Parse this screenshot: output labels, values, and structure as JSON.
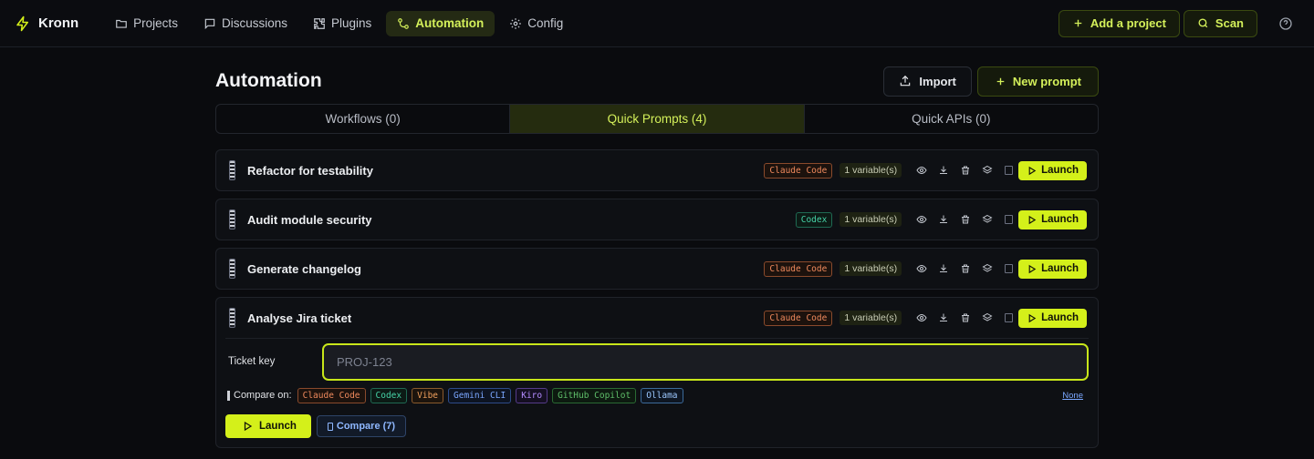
{
  "app": {
    "name": "Kronn",
    "colors": {
      "accent": "#d4f01a",
      "background": "#0a0b0e"
    }
  },
  "nav": {
    "items": [
      {
        "label": "Projects",
        "icon": "folder-icon"
      },
      {
        "label": "Discussions",
        "icon": "chat-icon"
      },
      {
        "label": "Plugins",
        "icon": "puzzle-icon"
      },
      {
        "label": "Automation",
        "icon": "workflow-icon",
        "active": true
      },
      {
        "label": "Config",
        "icon": "gear-icon"
      }
    ]
  },
  "topbar": {
    "add_project": "Add a project",
    "scan": "Scan"
  },
  "page": {
    "title": "Automation",
    "import_label": "Import",
    "new_prompt_label": "New prompt"
  },
  "tabs": [
    {
      "label": "Workflows (0)"
    },
    {
      "label": "Quick Prompts (4)",
      "active": true
    },
    {
      "label": "Quick APIs (0)"
    }
  ],
  "prompts": [
    {
      "title": "Refactor for testability",
      "agent": "Claude Code",
      "variables": "1 variable(s)",
      "launch": "Launch"
    },
    {
      "title": "Audit module security",
      "agent": "Codex",
      "variables": "1 variable(s)",
      "launch": "Launch"
    },
    {
      "title": "Generate changelog",
      "agent": "Claude Code",
      "variables": "1 variable(s)",
      "launch": "Launch"
    },
    {
      "title": "Analyse Jira ticket",
      "agent": "Claude Code",
      "variables": "1 variable(s)",
      "launch": "Launch"
    }
  ],
  "expanded": {
    "variable_label": "Ticket key",
    "variable_value": "",
    "variable_placeholder": "PROJ-123",
    "compare_label": "Compare on:",
    "agents": [
      "Claude Code",
      "Codex",
      "Vibe",
      "Gemini CLI",
      "Kiro",
      "GitHub Copilot",
      "Ollama"
    ],
    "none_label": "None",
    "launch_label": "Launch",
    "compare_button": "Compare (7)"
  }
}
